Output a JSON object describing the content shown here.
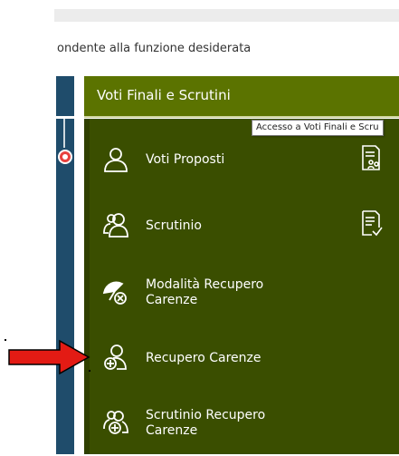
{
  "instruction_text": "ondente alla funzione desiderata",
  "header": {
    "title": "Voti Finali e Scrutini"
  },
  "tooltip": {
    "text": "Accesso a Voti Finali e Scru"
  },
  "colors": {
    "header_bg": "#5b7300",
    "menu_bg": "#3a4e00",
    "left_panel": "#1f4c6b",
    "arrow": "#e31b14"
  },
  "menu": {
    "items": [
      {
        "label": "Voti Proposti",
        "icon": "person-icon",
        "right_icon": "document-people-icon"
      },
      {
        "label": "Scrutinio",
        "icon": "group-icon",
        "right_icon": "document-check-icon"
      },
      {
        "label_line1": "Modalità Recupero",
        "label_line2": "Carenze",
        "icon": "umbrella-cancel-icon"
      },
      {
        "label": "Recupero Carenze",
        "icon": "person-plus-icon"
      },
      {
        "label_line1": "Scrutinio Recupero",
        "label_line2": "Carenze",
        "icon": "group-plus-icon"
      }
    ]
  }
}
